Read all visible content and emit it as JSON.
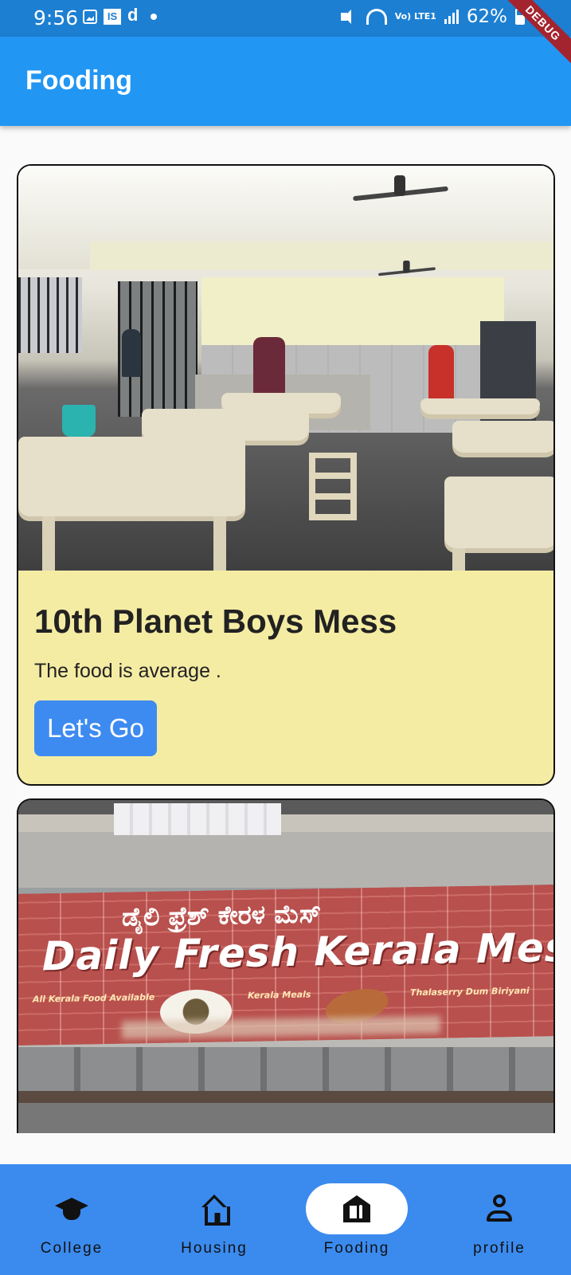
{
  "status_bar": {
    "time": "9:56",
    "carrier_glyph": "d",
    "network": "Vo) LTE1",
    "battery": "62%",
    "debug_banner": "DEBUG"
  },
  "app_bar": {
    "title": "Fooding"
  },
  "cards": [
    {
      "title": "10th Planet Boys Mess",
      "description": "The food is average .",
      "button_label": "Let's Go",
      "image": "mess-dining-hall-photo"
    },
    {
      "image": "daily-fresh-kerala-mess-storefront-photo",
      "sign": {
        "kannada": "ಡೈಲಿ ಫ್ರೆಶ್ ಕೇರಳ ಮೆಸ್",
        "main": "Daily Fresh Kerala Mess",
        "sub_left": "All Kerala Food Available",
        "sub_middle": "Kerala Meals",
        "sub_right": "Thalaserry Dum Biriyani"
      }
    }
  ],
  "bottom_nav": {
    "items": [
      {
        "label": "College",
        "icon": "graduation-cap-icon"
      },
      {
        "label": "Housing",
        "icon": "house-icon"
      },
      {
        "label": "Fooding",
        "icon": "restaurant-icon",
        "active": true
      },
      {
        "label": "profile",
        "icon": "person-icon"
      }
    ]
  },
  "colors": {
    "status_bar": "#1d7fd1",
    "app_bar": "#2196f3",
    "card_background": "#f5eca4",
    "button": "#3d8bf0",
    "bottom_nav": "#3b8bef",
    "debug_banner": "#a3242f"
  }
}
